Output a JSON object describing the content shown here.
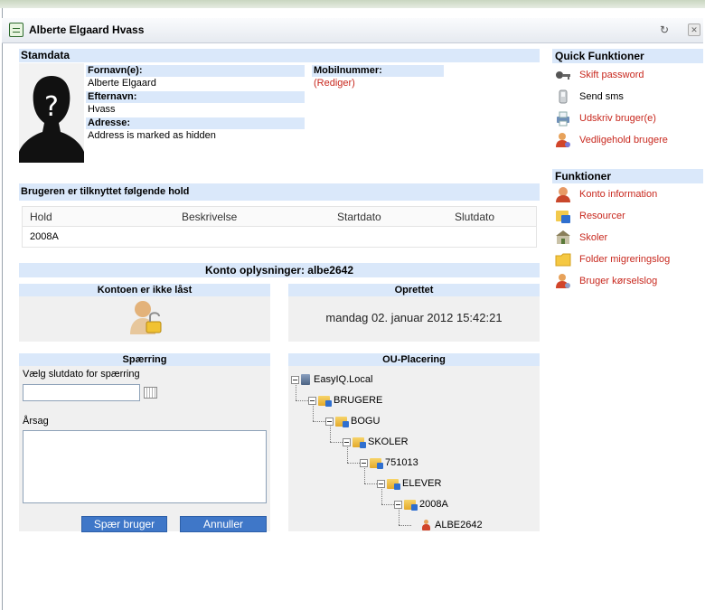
{
  "window": {
    "title": "Alberte Elgaard Hvass"
  },
  "stamdata": {
    "header": "Stamdata",
    "fornavn_label": "Fornavn(e):",
    "fornavn_value": "Alberte Elgaard",
    "efternavn_label": "Efternavn:",
    "efternavn_value": "Hvass",
    "adresse_label": "Adresse:",
    "adresse_value": "Address is marked as hidden",
    "mobil_label": "Mobilnummer:",
    "mobil_value": "(Rediger)"
  },
  "hold": {
    "header": "Brugeren er tilknyttet følgende hold",
    "columns": [
      "Hold",
      "Beskrivelse",
      "Startdato",
      "Slutdato"
    ],
    "rows": [
      {
        "hold": "2008A",
        "beskrivelse": "",
        "startdato": "",
        "slutdato": ""
      }
    ]
  },
  "konto": {
    "header": "Konto oplysninger: albe2642",
    "lock_header": "Kontoen er ikke låst",
    "created_header": "Oprettet",
    "created_value": "mandag 02. januar 2012 15:42:21"
  },
  "spaerring": {
    "header": "Spærring",
    "date_label": "Vælg slutdato for spærring",
    "date_value": "",
    "reason_label": "Årsag",
    "reason_value": "",
    "block_button": "Spær bruger",
    "cancel_button": "Annuller"
  },
  "ou": {
    "header": "OU-Placering",
    "nodes": [
      {
        "label": "EasyIQ.Local",
        "icon": "server-icon",
        "level": 0
      },
      {
        "label": "BRUGERE",
        "icon": "folder-icon",
        "level": 1
      },
      {
        "label": "BOGU",
        "icon": "folder-icon",
        "level": 2
      },
      {
        "label": "SKOLER",
        "icon": "folder-icon",
        "level": 3
      },
      {
        "label": "751013",
        "icon": "folder-icon",
        "level": 4
      },
      {
        "label": "ELEVER",
        "icon": "folder-icon",
        "level": 5
      },
      {
        "label": "2008A",
        "icon": "folder-icon",
        "level": 6
      },
      {
        "label": "ALBE2642",
        "icon": "user-icon",
        "level": 7
      }
    ]
  },
  "quick": {
    "header": "Quick Funktioner",
    "items": [
      {
        "label": "Skift password",
        "icon": "key-icon",
        "link": true
      },
      {
        "label": "Send sms",
        "icon": "phone-icon",
        "link": false
      },
      {
        "label": "Udskriv bruger(e)",
        "icon": "printer-icon",
        "link": true
      },
      {
        "label": "Vedligehold brugere",
        "icon": "users-icon",
        "link": true
      }
    ]
  },
  "funktioner": {
    "header": "Funktioner",
    "items": [
      {
        "label": "Konto information",
        "icon": "account-icon"
      },
      {
        "label": "Resourcer",
        "icon": "resources-icon"
      },
      {
        "label": "Skoler",
        "icon": "school-icon"
      },
      {
        "label": "Folder migreringslog",
        "icon": "folder-icon"
      },
      {
        "label": "Bruger kørselslog",
        "icon": "user-log-icon"
      }
    ]
  },
  "colors": {
    "section_bg": "#dae8fa",
    "link": "#c8281e",
    "button": "#3f77c8"
  }
}
